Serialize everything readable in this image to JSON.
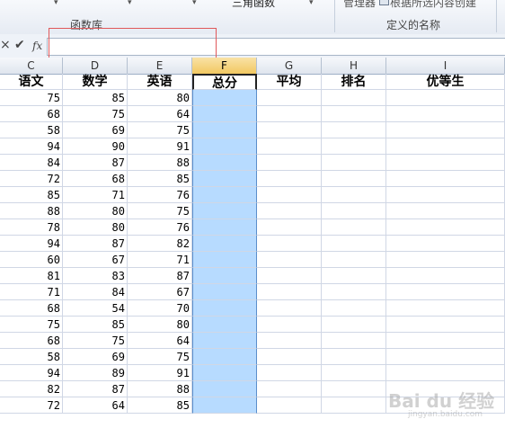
{
  "ribbon": {
    "group_function_library": "函数库",
    "common_functions_label": "三角函数",
    "name_manager_label": "管理器",
    "create_from_selection_label": "根据所选内容创建",
    "defined_names_group": "定义的名称"
  },
  "formula_bar": {
    "cancel_icon": "×",
    "enter_icon": "✔",
    "fx_icon": "fx",
    "value": ""
  },
  "columns": [
    "C",
    "D",
    "E",
    "F",
    "G",
    "H",
    "I"
  ],
  "selected_column": "F",
  "headers": [
    "语文",
    "数学",
    "英语",
    "总分",
    "平均",
    "排名",
    "优等生"
  ],
  "rows": [
    [
      "75",
      "85",
      "80"
    ],
    [
      "68",
      "75",
      "64"
    ],
    [
      "58",
      "69",
      "75"
    ],
    [
      "94",
      "90",
      "91"
    ],
    [
      "84",
      "87",
      "88"
    ],
    [
      "72",
      "68",
      "85"
    ],
    [
      "85",
      "71",
      "76"
    ],
    [
      "88",
      "80",
      "75"
    ],
    [
      "78",
      "80",
      "76"
    ],
    [
      "94",
      "87",
      "82"
    ],
    [
      "60",
      "67",
      "71"
    ],
    [
      "81",
      "83",
      "87"
    ],
    [
      "71",
      "84",
      "67"
    ],
    [
      "68",
      "54",
      "70"
    ],
    [
      "75",
      "85",
      "80"
    ],
    [
      "68",
      "75",
      "64"
    ],
    [
      "58",
      "69",
      "75"
    ],
    [
      "94",
      "89",
      "91"
    ],
    [
      "82",
      "87",
      "88"
    ],
    [
      "72",
      "64",
      "85"
    ]
  ],
  "watermark": {
    "main": "Bai du 经验",
    "sub": "jingyan.baidu.com"
  },
  "colors": {
    "selection_fill": "#b7dbff",
    "selected_header": "#f2c861",
    "annotation_box": "#e0585a"
  }
}
